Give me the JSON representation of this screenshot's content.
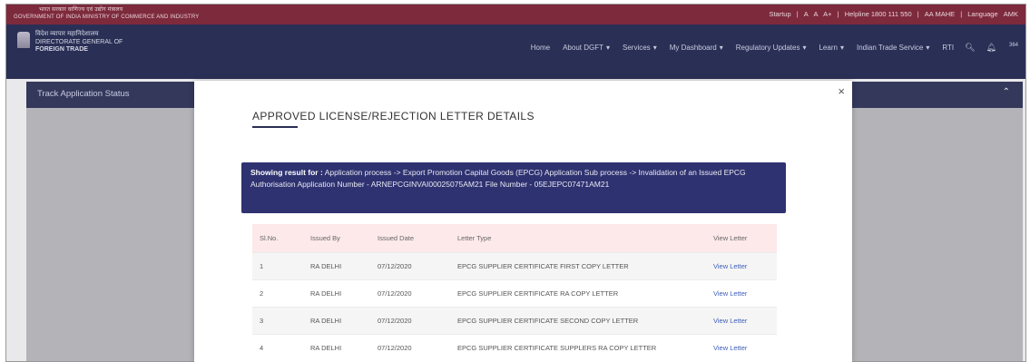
{
  "header": {
    "gov_line1": "भारत सरकार  वाणिज्य एवं उद्योग मंत्रालय",
    "gov_line2": "GOVERNMENT OF INDIA  MINISTRY OF COMMERCE AND INDUSTRY",
    "util_links": [
      "Startup",
      "|",
      "A",
      "A",
      "A+",
      "|",
      "Helpline 1800 111 550",
      "|",
      "AA MAHE",
      "|",
      "Language",
      "AMK"
    ]
  },
  "brand": {
    "hindi": "विदेश व्यापार महानिदेशालय",
    "line1": "DIRECTORATE GENERAL OF",
    "line2": "FOREIGN TRADE"
  },
  "nav": {
    "items": [
      "Home",
      "About DGFT",
      "Services",
      "My Dashboard",
      "Regulatory Updates",
      "Learn",
      "Indian Trade Service",
      "RTI"
    ],
    "notif_count": "364"
  },
  "track": {
    "title": "Track Application Status"
  },
  "modal": {
    "title": "APPROVED LICENSE/REJECTION LETTER DETAILS",
    "result_label": "Showing result for :",
    "result_text": " Application process -> Export Promotion Capital Goods (EPCG) Application Sub process -> Invalidation of an Issued EPCG Authorisation Application Number - ARNEPCGINVAI00025075AM21 File Number - 05EJEPC07471AM21"
  },
  "table": {
    "headers": [
      "Sl.No.",
      "Issued By",
      "Issued Date",
      "Letter Type",
      "View Letter"
    ],
    "rows": [
      [
        "1",
        "RA DELHI",
        "07/12/2020",
        "EPCG SUPPLIER CERTIFICATE FIRST COPY LETTER",
        "View Letter"
      ],
      [
        "2",
        "RA DELHI",
        "07/12/2020",
        "EPCG SUPPLIER CERTIFICATE RA COPY LETTER",
        "View Letter"
      ],
      [
        "3",
        "RA DELHI",
        "07/12/2020",
        "EPCG SUPPLIER CERTIFICATE SECOND COPY LETTER",
        "View Letter"
      ],
      [
        "4",
        "RA DELHI",
        "07/12/2020",
        "EPCG SUPPLIER CERTIFICATE SUPPLERS RA COPY LETTER",
        "View Letter"
      ]
    ]
  },
  "colors": {
    "util_bar": "#7d2a3c",
    "nav_bar": "#2a2f55",
    "result_box": "#2e3270",
    "table_header": "#fde9ea",
    "link": "#3e5fb7"
  }
}
